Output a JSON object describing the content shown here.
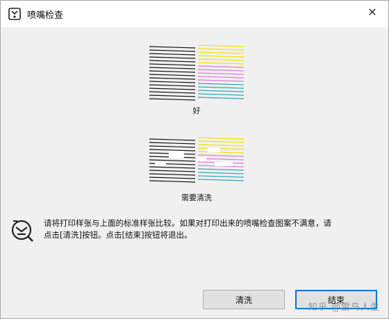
{
  "window": {
    "title": "喷嘴检查",
    "close_glyph": "✕"
  },
  "patterns": {
    "good_caption": "好",
    "needs_cleaning_caption": "需要清洗"
  },
  "message": {
    "line1": "请将打印样张与上面的标准样张比较。如果对打印出来的喷嘴检查图案不满意，请",
    "line2": "点击[清洗]按钮。点击[结束]按钮将退出。"
  },
  "buttons": {
    "clean_label": "清洗",
    "finish_label": "结束"
  },
  "watermark": "知乎 @雷鸟人生",
  "colors": {
    "black": "#111111",
    "yellow": "#f2e600",
    "magenta": "#e07ad6",
    "cyan": "#2fa7b6",
    "accent": "#0078d7"
  }
}
